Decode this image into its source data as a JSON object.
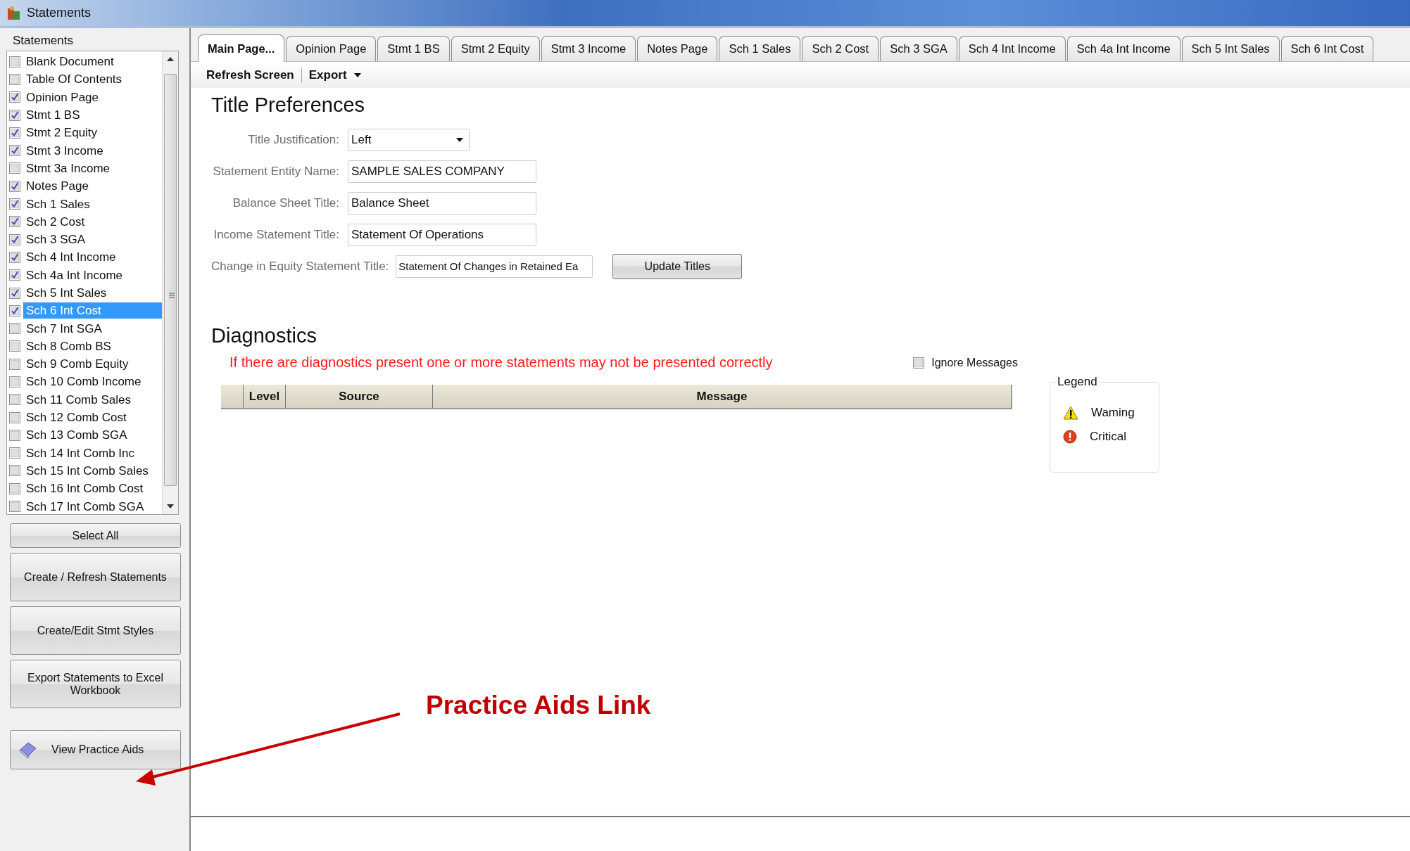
{
  "window": {
    "title": "Statements"
  },
  "sidebar": {
    "label": "Statements",
    "items": [
      {
        "label": "Blank Document",
        "checked": false,
        "selected": false
      },
      {
        "label": "Table Of Contents",
        "checked": false,
        "selected": false
      },
      {
        "label": "Opinion Page",
        "checked": true,
        "selected": false
      },
      {
        "label": "Stmt 1 BS",
        "checked": true,
        "selected": false
      },
      {
        "label": "Stmt 2 Equity",
        "checked": true,
        "selected": false
      },
      {
        "label": "Stmt 3 Income",
        "checked": true,
        "selected": false
      },
      {
        "label": "Stmt 3a Income",
        "checked": false,
        "selected": false
      },
      {
        "label": "Notes Page",
        "checked": true,
        "selected": false
      },
      {
        "label": "Sch 1 Sales",
        "checked": true,
        "selected": false
      },
      {
        "label": "Sch 2 Cost",
        "checked": true,
        "selected": false
      },
      {
        "label": "Sch 3 SGA",
        "checked": true,
        "selected": false
      },
      {
        "label": "Sch 4 Int Income",
        "checked": true,
        "selected": false
      },
      {
        "label": "Sch 4a Int Income",
        "checked": true,
        "selected": false
      },
      {
        "label": "Sch 5 Int Sales",
        "checked": true,
        "selected": false
      },
      {
        "label": "Sch 6 Int Cost",
        "checked": true,
        "selected": true
      },
      {
        "label": "Sch 7 Int SGA",
        "checked": false,
        "selected": false
      },
      {
        "label": "Sch 8 Comb BS",
        "checked": false,
        "selected": false
      },
      {
        "label": "Sch 9 Comb Equity",
        "checked": false,
        "selected": false
      },
      {
        "label": "Sch 10 Comb Income",
        "checked": false,
        "selected": false
      },
      {
        "label": "Sch 11 Comb Sales",
        "checked": false,
        "selected": false
      },
      {
        "label": "Sch 12 Comb Cost",
        "checked": false,
        "selected": false
      },
      {
        "label": "Sch 13 Comb SGA",
        "checked": false,
        "selected": false
      },
      {
        "label": "Sch 14 Int Comb Inc",
        "checked": false,
        "selected": false
      },
      {
        "label": "Sch 15 Int Comb Sales",
        "checked": false,
        "selected": false
      },
      {
        "label": "Sch 16 Int Comb Cost",
        "checked": false,
        "selected": false
      },
      {
        "label": "Sch 17 Int Comb SGA",
        "checked": false,
        "selected": false
      }
    ],
    "buttons": [
      {
        "label": "Select All",
        "kind": "small"
      },
      {
        "label": "Create / Refresh Statements",
        "kind": "large"
      },
      {
        "label": "Create/Edit Stmt Styles",
        "kind": "large"
      },
      {
        "label": "Export Statements to Excel Workbook",
        "kind": "large"
      },
      {
        "label": "View Practice Aids",
        "kind": "icon"
      }
    ]
  },
  "tabs": [
    {
      "label": "Main Page...",
      "selected": true
    },
    {
      "label": "Opinion Page",
      "selected": false
    },
    {
      "label": "Stmt 1 BS",
      "selected": false
    },
    {
      "label": "Stmt 2 Equity",
      "selected": false
    },
    {
      "label": "Stmt 3 Income",
      "selected": false
    },
    {
      "label": "Notes Page",
      "selected": false
    },
    {
      "label": "Sch 1 Sales",
      "selected": false
    },
    {
      "label": "Sch 2 Cost",
      "selected": false
    },
    {
      "label": "Sch 3 SGA",
      "selected": false
    },
    {
      "label": "Sch 4 Int Income",
      "selected": false
    },
    {
      "label": "Sch 4a Int Income",
      "selected": false
    },
    {
      "label": "Sch 5 Int Sales",
      "selected": false
    },
    {
      "label": "Sch 6 Int Cost",
      "selected": false
    }
  ],
  "toolbar": [
    {
      "label": "Refresh Screen",
      "kind": "button"
    },
    {
      "label": "Export",
      "kind": "dropdown"
    }
  ],
  "title_preferences": {
    "heading": "Title Preferences",
    "fields": [
      {
        "label": "Title Justification:",
        "value": "Left",
        "kind": "dropdown"
      },
      {
        "label": "Statement Entity Name:",
        "value": "SAMPLE SALES COMPANY",
        "kind": "text"
      },
      {
        "label": "Balance Sheet Title:",
        "value": "Balance Sheet",
        "kind": "text"
      },
      {
        "label": "Income Statement Title:",
        "value": "Statement Of Operations",
        "kind": "text"
      }
    ],
    "equity_field": {
      "label": "Change in Equity Statement Title:",
      "value": "Statement Of Changes in Retained Ea"
    },
    "update_button": "Update Titles"
  },
  "diagnostics": {
    "heading": "Diagnostics",
    "notice": "If there are diagnostics present one or more statements may not be presented correctly",
    "ignore_messages": {
      "label": "Ignore Messages",
      "checked": false
    },
    "table": {
      "columns": [
        {
          "label": "Level"
        },
        {
          "label": "Source"
        },
        {
          "label": "Message"
        }
      ]
    },
    "legend": {
      "title": "Legend",
      "items": [
        {
          "label": "Waming",
          "kind": "warning"
        },
        {
          "label": "Critical",
          "kind": "critical"
        }
      ]
    }
  },
  "annotation": {
    "label": "Practice Aids Link"
  }
}
